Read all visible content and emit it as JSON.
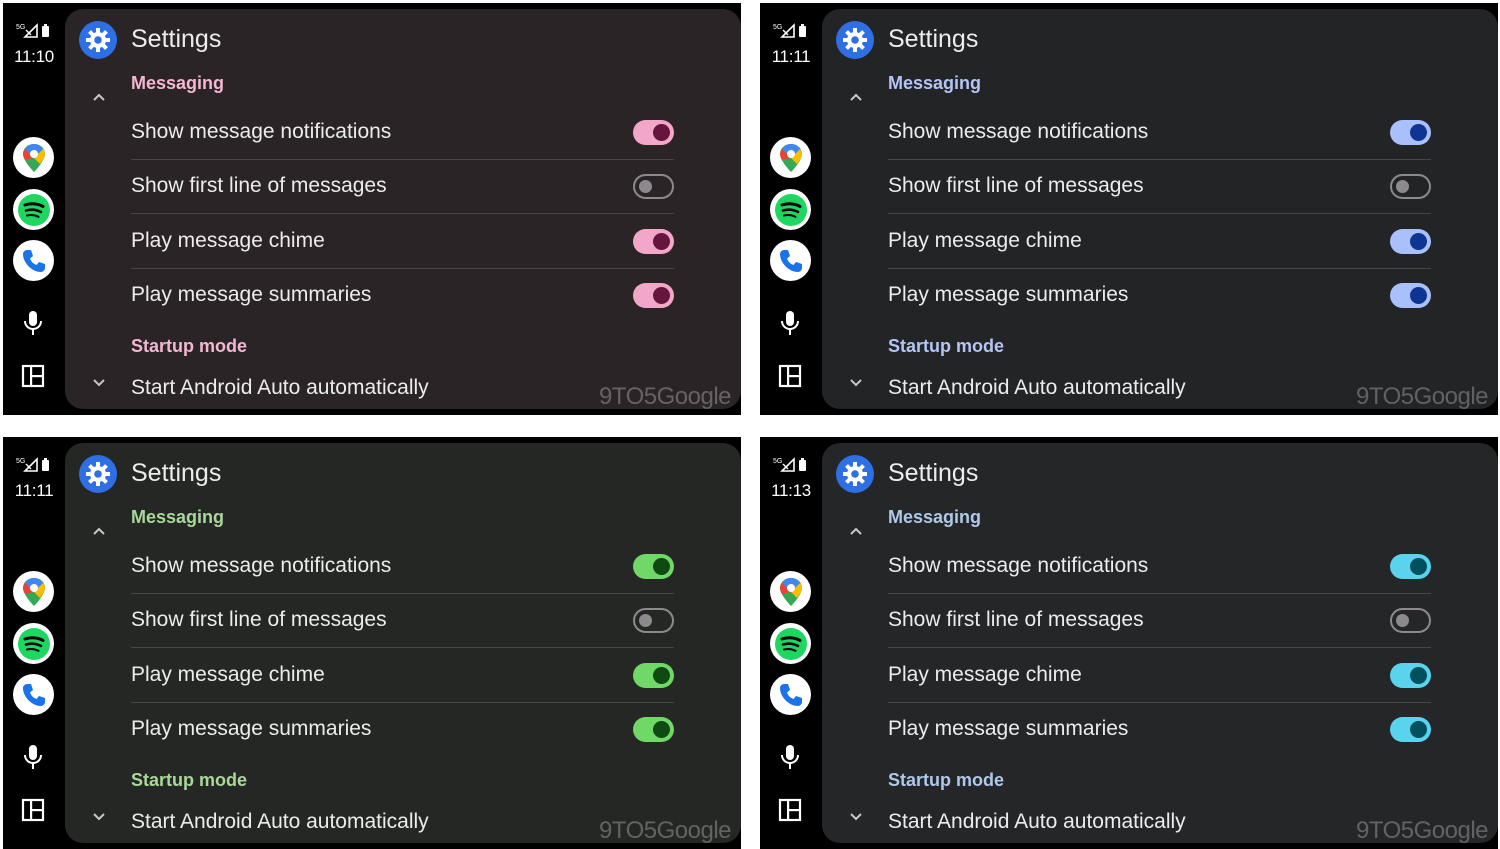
{
  "panels": [
    {
      "theme": "pink",
      "clock": "11:10",
      "title": "Settings",
      "section_messaging": "Messaging",
      "section_startup": "Startup mode",
      "toggles": [
        {
          "label": "Show message notifications",
          "on": true
        },
        {
          "label": "Show first line of messages",
          "on": false
        },
        {
          "label": "Play message chime",
          "on": true
        },
        {
          "label": "Play message summaries",
          "on": true
        }
      ],
      "startup_item": "Start Android Auto automatically",
      "watermark": "9TO5Google"
    },
    {
      "theme": "blue",
      "clock": "11:11",
      "title": "Settings",
      "section_messaging": "Messaging",
      "section_startup": "Startup mode",
      "toggles": [
        {
          "label": "Show message notifications",
          "on": true
        },
        {
          "label": "Show first line of messages",
          "on": false
        },
        {
          "label": "Play message chime",
          "on": true
        },
        {
          "label": "Play message summaries",
          "on": true
        }
      ],
      "startup_item": "Start Android Auto automatically",
      "watermark": "9TO5Google"
    },
    {
      "theme": "green",
      "clock": "11:11",
      "title": "Settings",
      "section_messaging": "Messaging",
      "section_startup": "Startup mode",
      "toggles": [
        {
          "label": "Show message notifications",
          "on": true
        },
        {
          "label": "Show first line of messages",
          "on": false
        },
        {
          "label": "Play message chime",
          "on": true
        },
        {
          "label": "Play message summaries",
          "on": true
        }
      ],
      "startup_item": "Start Android Auto automatically",
      "watermark": "9TO5Google"
    },
    {
      "theme": "cyan",
      "clock": "11:13",
      "title": "Settings",
      "section_messaging": "Messaging",
      "section_startup": "Startup mode",
      "toggles": [
        {
          "label": "Show message notifications",
          "on": true
        },
        {
          "label": "Show first line of messages",
          "on": false
        },
        {
          "label": "Play message chime",
          "on": true
        },
        {
          "label": "Play message summaries",
          "on": true
        }
      ],
      "startup_item": "Start Android Auto automatically",
      "watermark": "9TO5Google"
    }
  ],
  "status": {
    "network": "5G"
  },
  "icons": {
    "settings": "gear-icon",
    "maps": "google-maps-icon",
    "spotify": "spotify-icon",
    "phone": "phone-icon",
    "assistant": "microphone-icon",
    "dashboard": "dashboard-icon",
    "collapse": "chevron-up-icon",
    "expand": "chevron-down-icon"
  }
}
